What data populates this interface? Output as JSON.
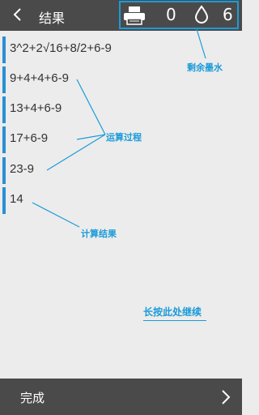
{
  "header": {
    "title": "结果",
    "ink_left": "0",
    "ink_right": "6"
  },
  "steps": [
    "3^2+2√16+8/2+6-9",
    "9+4+4+6-9",
    "13+4+6-9",
    "17+6-9",
    "23-9",
    "14"
  ],
  "annotations": {
    "remaining_ink": "剩余墨水",
    "process": "运算过程",
    "result": "计算结果",
    "continue": "长按此处继续"
  },
  "footer": {
    "done_label": "完成"
  },
  "colors": {
    "bar": "#4a4a4a",
    "accent": "#1b9bd8",
    "step_marker": "#2a8fd3",
    "background": "#ececec"
  }
}
